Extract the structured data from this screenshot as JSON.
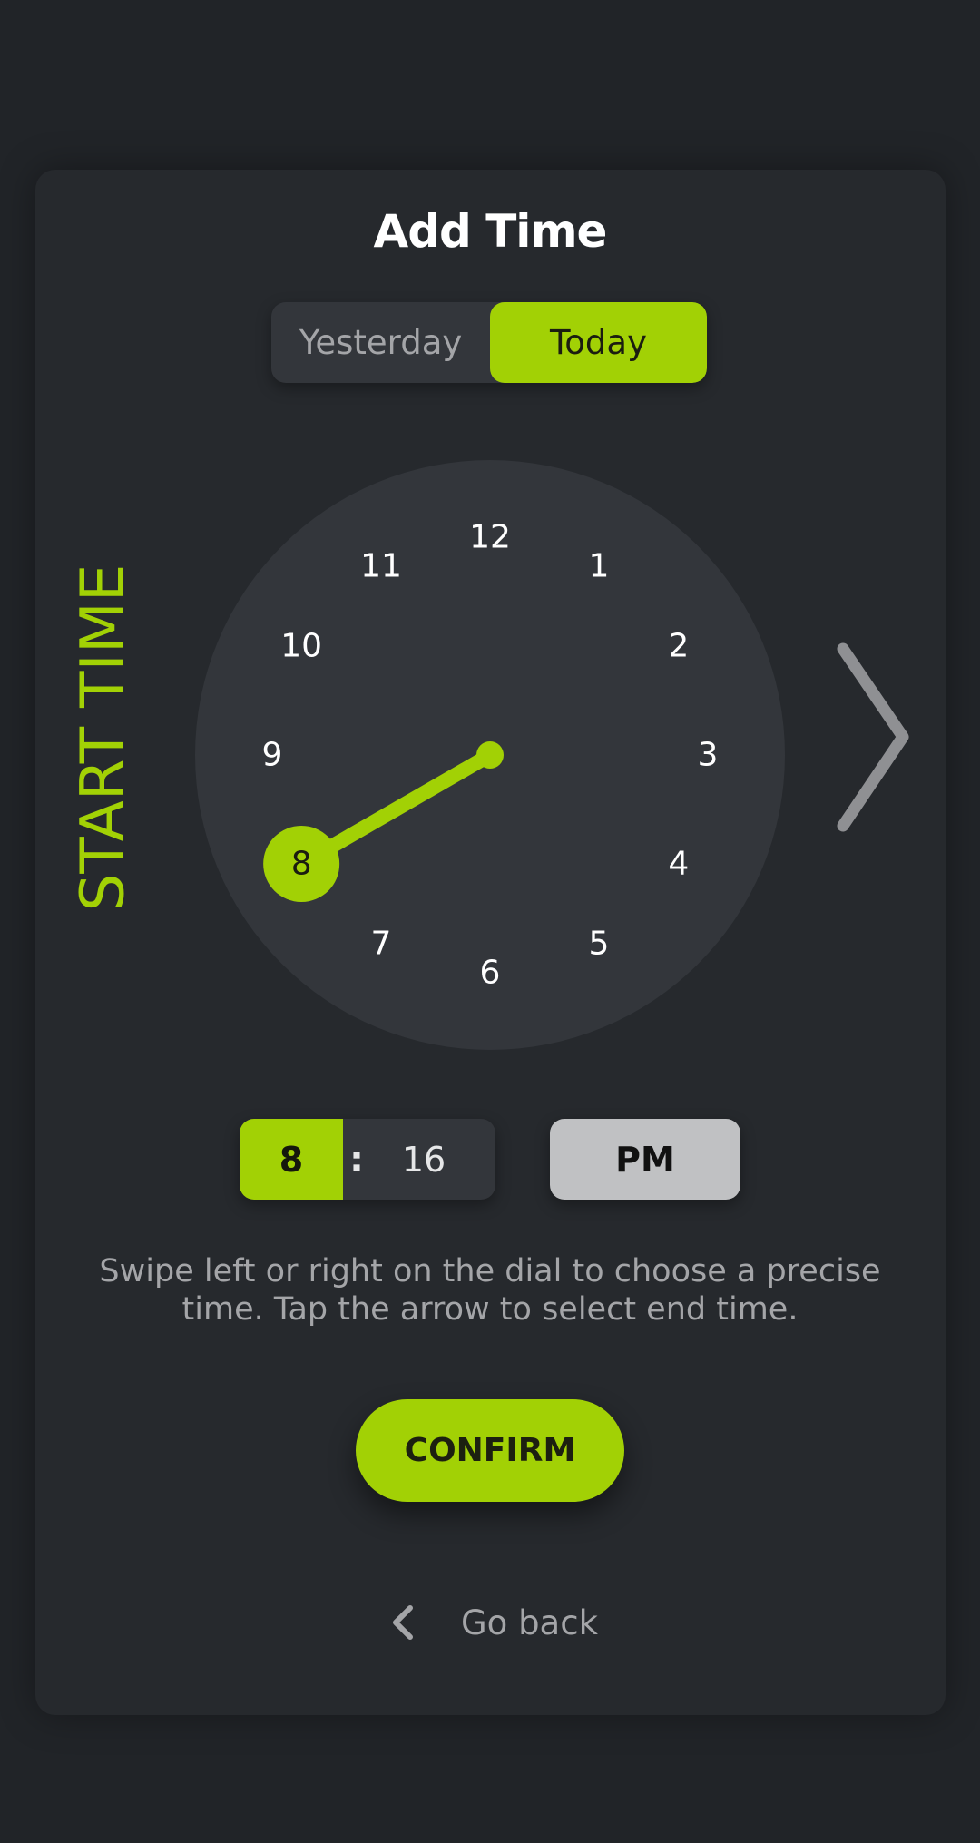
{
  "screen": {
    "title": "Add Time",
    "mode_label": "START TIME"
  },
  "day_toggle": {
    "options": [
      "Yesterday",
      "Today"
    ],
    "selected": "Today"
  },
  "dial": {
    "numbers": [
      "12",
      "1",
      "2",
      "3",
      "4",
      "5",
      "6",
      "7",
      "8",
      "9",
      "10",
      "11"
    ],
    "selected_hour": "8",
    "icons": {
      "next": "chevron-right-icon",
      "back": "chevron-left-icon"
    }
  },
  "time": {
    "hour": "8",
    "separator": ":",
    "minute": "16",
    "period": "PM"
  },
  "instructions": "Swipe left or right on the dial to choose a precise time. Tap the arrow to select end time.",
  "confirm_label": "CONFIRM",
  "go_back_label": "Go back",
  "colors": {
    "accent": "#a2d105",
    "background": "#212428",
    "card": "#26292d",
    "dial_face": "#33363b"
  }
}
